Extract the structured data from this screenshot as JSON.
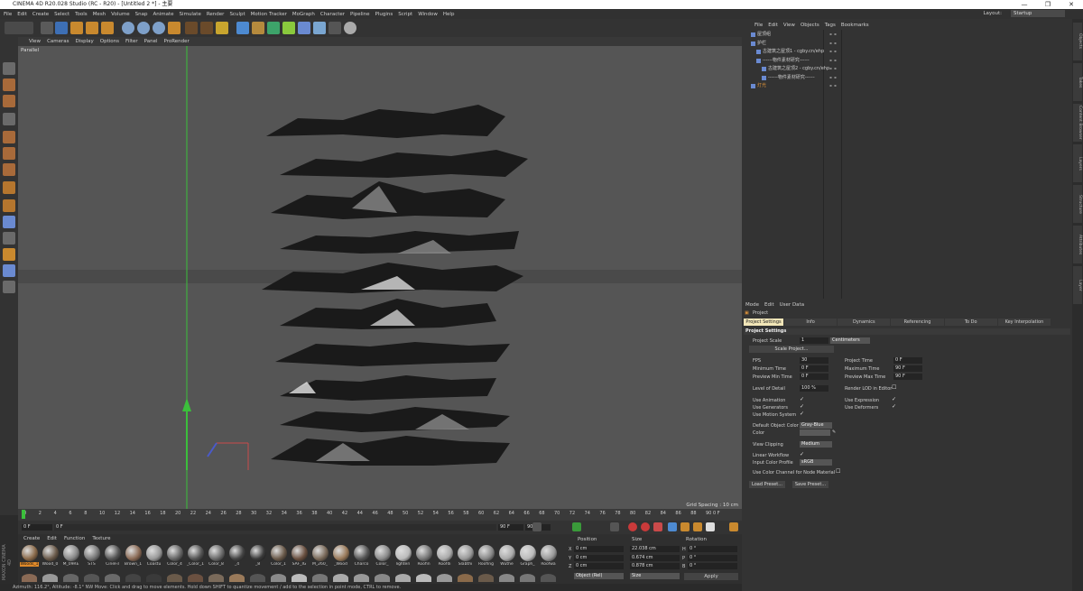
{
  "window": {
    "title": "CINEMA 4D R20.028 Studio (RC - R20) - [Untitled 2 *] - 主要",
    "controls": [
      "—",
      "❐",
      "✕"
    ]
  },
  "menu": [
    "File",
    "Edit",
    "Create",
    "Select",
    "Tools",
    "Mesh",
    "Volume",
    "Snap",
    "Animate",
    "Simulate",
    "Render",
    "Sculpt",
    "Motion Tracker",
    "MoGraph",
    "Character",
    "Pipeline",
    "Plugins",
    "Script",
    "Window",
    "Help"
  ],
  "layout": {
    "label": "Layout:",
    "value": "Startup"
  },
  "viewport": {
    "menu": [
      "View",
      "Cameras",
      "Display",
      "Options",
      "Filter",
      "Panel",
      "ProRender"
    ],
    "camera_label": "Parallel",
    "grid_spacing": "Grid Spacing : 10 cm"
  },
  "timeline": {
    "ticks": [
      "0",
      "2",
      "4",
      "6",
      "8",
      "10",
      "12",
      "14",
      "16",
      "18",
      "20",
      "22",
      "24",
      "26",
      "28",
      "30",
      "32",
      "34",
      "36",
      "38",
      "40",
      "42",
      "44",
      "46",
      "48",
      "50",
      "52",
      "54",
      "56",
      "58",
      "60",
      "62",
      "64",
      "66",
      "68",
      "70",
      "72",
      "74",
      "76",
      "78",
      "80",
      "82",
      "84",
      "86",
      "88",
      "90"
    ],
    "end_frame": "0 F"
  },
  "transport": {
    "start": "0 F",
    "current": "0 F",
    "end": "90 F",
    "end2": "90 F"
  },
  "materials": {
    "menu": [
      "Create",
      "Edit",
      "Function",
      "Texture"
    ],
    "items": [
      {
        "name": "Woods_1",
        "active": true
      },
      {
        "name": "Wood_0",
        "active": false
      },
      {
        "name": "M_09RE",
        "active": false
      },
      {
        "name": "STS",
        "active": false
      },
      {
        "name": "CineFil",
        "active": false
      },
      {
        "name": "Brown_1",
        "active": false
      },
      {
        "name": "Coastu",
        "active": false
      },
      {
        "name": "Color_4",
        "active": false
      },
      {
        "name": "_Color_1",
        "active": false
      },
      {
        "name": "Color_8",
        "active": false
      },
      {
        "name": "_4",
        "active": false
      },
      {
        "name": "_8",
        "active": false
      },
      {
        "name": "Color_1",
        "active": false
      },
      {
        "name": "SAF_IG",
        "active": false
      },
      {
        "name": "M_260_",
        "active": false
      },
      {
        "name": "_Wood",
        "active": false
      },
      {
        "name": "Charco",
        "active": false
      },
      {
        "name": "Color_",
        "active": false
      },
      {
        "name": "lighteri",
        "active": false
      },
      {
        "name": "Roofin",
        "active": false
      },
      {
        "name": "Roofdi",
        "active": false
      },
      {
        "name": "Slabthi",
        "active": false
      },
      {
        "name": "Roofing",
        "active": false
      },
      {
        "name": "Wuthe",
        "active": false
      },
      {
        "name": "Graph_",
        "active": false
      },
      {
        "name": "Roofwa",
        "active": false
      }
    ]
  },
  "coords": {
    "headers": [
      "Position",
      "Size",
      "Rotation"
    ],
    "rows": [
      {
        "axis": "X",
        "pos": "0 cm",
        "size": "22.038 cm",
        "rot_axis": "H",
        "rot": "0 °"
      },
      {
        "axis": "Y",
        "pos": "0 cm",
        "size": "0.674 cm",
        "rot_axis": "P",
        "rot": "0 °"
      },
      {
        "axis": "Z",
        "pos": "0 cm",
        "size": "0.878 cm",
        "rot_axis": "B",
        "rot": "0 °"
      }
    ],
    "mode": "Object (Rel)",
    "size_mode": "Size",
    "apply": "Apply"
  },
  "status": "Azimuth: 116.2°, Altitude: -8.1° NW     Move: Click and drag to move elements. Hold down SHIFT to quantize movement / add to the selection in point mode, CTRL to remove.",
  "brand": "MAXON CINEMA 4D",
  "objects": {
    "menu": [
      "File",
      "Edit",
      "View",
      "Objects",
      "Tags",
      "Bookmarks"
    ],
    "rows": [
      {
        "name": "屋顶组",
        "indent": 0,
        "color": "#cfcfcf"
      },
      {
        "name": "护栏",
        "indent": 0,
        "color": "#cfcfcf"
      },
      {
        "name": "古建筑之屋顶1 - cgby.cn/ehp",
        "indent": 1,
        "color": "#cfcfcf"
      },
      {
        "name": "------物件素材研究------",
        "indent": 1,
        "color": "#cfcfcf"
      },
      {
        "name": "古建筑之屋顶2 - cgby.cn/ehp",
        "indent": 2,
        "color": "#cfcfcf"
      },
      {
        "name": "------物件素材研究------",
        "indent": 2,
        "color": "#cfcfcf"
      },
      {
        "name": "灯光",
        "indent": 0,
        "color": "#e0943a"
      }
    ]
  },
  "attributes": {
    "menu": [
      "Mode",
      "Edit",
      "User Data"
    ],
    "title": "Project",
    "tabs": [
      "Project Settings",
      "Info",
      "Dynamics",
      "Referencing",
      "To Do",
      "Key Interpolation"
    ],
    "section": "Project Settings",
    "project_scale_label": "Project Scale",
    "project_scale_value": "1",
    "project_scale_unit": "Centimeters",
    "scale_project_btn": "Scale Project...",
    "fps_label": "FPS",
    "fps_value": "30",
    "project_time_label": "Project Time",
    "project_time_value": "0 F",
    "min_time_label": "Minimum Time",
    "min_time_value": "0 F",
    "max_time_label": "Maximum Time",
    "max_time_value": "90 F",
    "prev_min_label": "Preview Min Time",
    "prev_min_value": "0 F",
    "prev_max_label": "Preview Max Time",
    "prev_max_value": "90 F",
    "lod_label": "Level of Detail",
    "lod_value": "100 %",
    "render_lod_label": "Render LOD in Editor",
    "use_anim_label": "Use Animation",
    "use_expr_label": "Use Expression",
    "use_gen_label": "Use Generators",
    "use_def_label": "Use Deformers",
    "use_motion_label": "Use Motion System",
    "def_obj_color_label": "Default Object Color",
    "def_obj_color_value": "Gray-Blue",
    "color_label": "Color",
    "view_clip_label": "View Clipping",
    "view_clip_value": "Medium",
    "linear_wf_label": "Linear Workflow",
    "input_profile_label": "Input Color Profile",
    "input_profile_value": "sRGB",
    "use_color_channel_label": "Use Color Channel for Node Material",
    "load_preset": "Load Preset...",
    "save_preset": "Save Preset..."
  },
  "right_tabs": [
    "Objects",
    "Takes",
    "Content Browser",
    "Layers",
    "Structure",
    "Attributes",
    "Layer"
  ]
}
